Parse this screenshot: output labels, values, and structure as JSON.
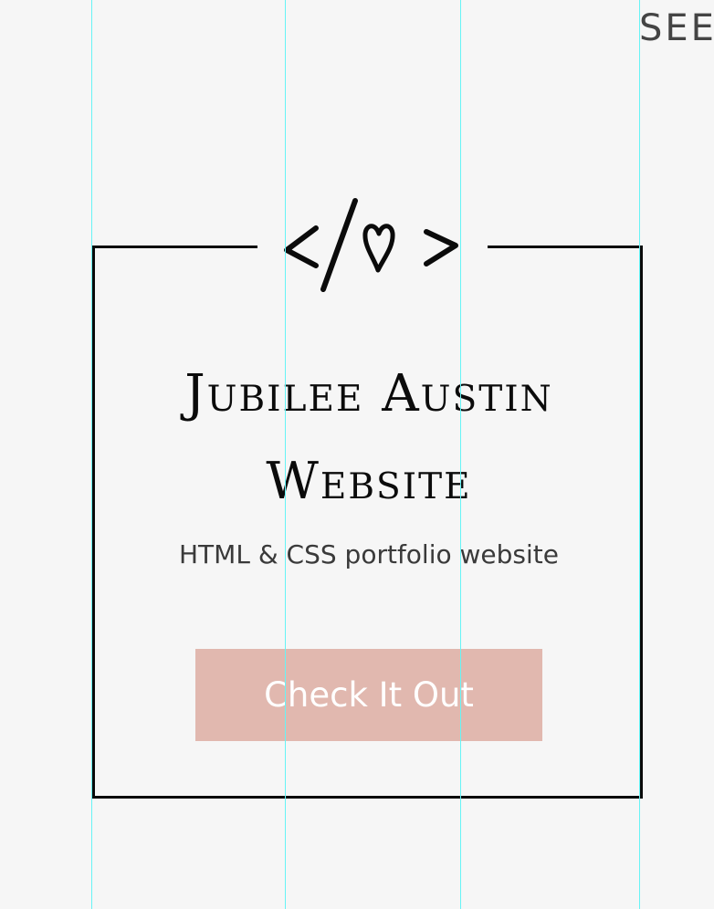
{
  "header": {
    "corner_text": "SEE"
  },
  "project": {
    "logo_icon": "code-heart-icon",
    "title": "Jubilee Austin Website",
    "description": "HTML & CSS portfolio website",
    "button_label": "Check It Out"
  },
  "colors": {
    "background": "#f6f6f6",
    "frame": "#0a0a0a",
    "button_bg": "#e1b8af",
    "button_text": "#ffffff",
    "guide_line": "#66f4f6"
  }
}
